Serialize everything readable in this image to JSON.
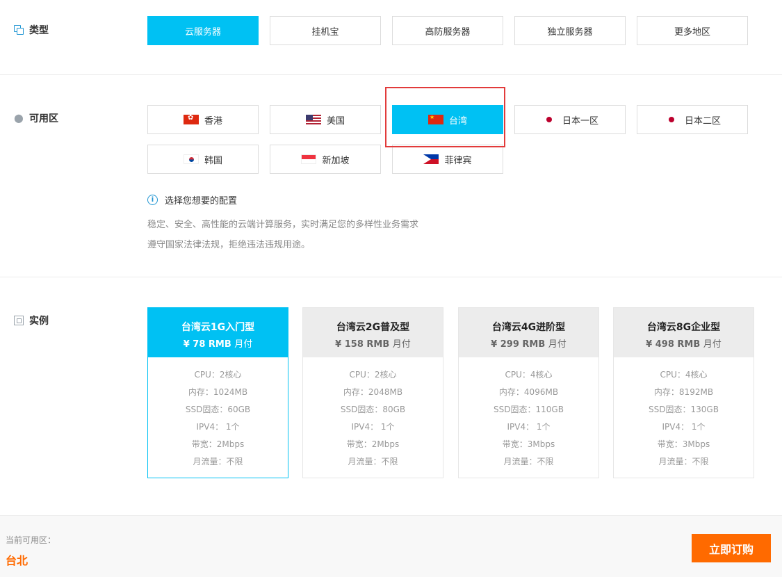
{
  "type_section": {
    "label": "类型",
    "icon": "copy-icon",
    "options": [
      "云服务器",
      "挂机宝",
      "高防服务器",
      "独立服务器",
      "更多地区"
    ],
    "selected": "云服务器"
  },
  "zone_section": {
    "label": "可用区",
    "icon": "location-pin-icon",
    "options": [
      {
        "label": "香港",
        "flag": "hong-kong-flag-icon"
      },
      {
        "label": "美国",
        "flag": "usa-flag-icon"
      },
      {
        "label": "台湾",
        "flag": "china-flag-icon"
      },
      {
        "label": "日本一区",
        "flag": "japan-flag-icon"
      },
      {
        "label": "日本二区",
        "flag": "japan-flag-icon"
      },
      {
        "label": "韩国",
        "flag": "korea-flag-icon"
      },
      {
        "label": "新加坡",
        "flag": "singapore-flag-icon"
      },
      {
        "label": "菲律宾",
        "flag": "philippines-flag-icon"
      }
    ],
    "selected": "台湾",
    "hint_title": "选择您想要的配置",
    "desc_line1": "稳定、安全、高性能的云端计算服务，实时满足您的多样性业务需求",
    "desc_line2": "遵守国家法律法规，拒绝违法违规用途。"
  },
  "instance_section": {
    "label": "实例",
    "icon": "instance-frame-icon",
    "cards": [
      {
        "name": "台湾云1G入门型",
        "price": "¥ 78 RMB",
        "unit": "月付",
        "specs": [
          "CPU：2核心",
          "内存：1024MB",
          "SSD固态：60GB",
          "IPV4： 1个",
          "带宽：2Mbps",
          "月流量：不限"
        ]
      },
      {
        "name": "台湾云2G普及型",
        "price": "¥ 158 RMB",
        "unit": "月付",
        "specs": [
          "CPU：2核心",
          "内存：2048MB",
          "SSD固态：80GB",
          "IPV4： 1个",
          "带宽：2Mbps",
          "月流量：不限"
        ]
      },
      {
        "name": "台湾云4G进阶型",
        "price": "¥ 299 RMB",
        "unit": "月付",
        "specs": [
          "CPU：4核心",
          "内存：4096MB",
          "SSD固态：110GB",
          "IPV4： 1个",
          "带宽：3Mbps",
          "月流量：不限"
        ]
      },
      {
        "name": "台湾云8G企业型",
        "price": "¥ 498 RMB",
        "unit": "月付",
        "specs": [
          "CPU：4核心",
          "内存：8192MB",
          "SSD固态：130GB",
          "IPV4： 1个",
          "带宽：3Mbps",
          "月流量：不限"
        ]
      }
    ],
    "selected_index": 0
  },
  "footer": {
    "current_zone_label": "当前可用区：",
    "current_zone_value": "台北",
    "order_button": "立即订购"
  },
  "colors": {
    "accent": "#00c1f3",
    "order": "#ff6a00",
    "highlight_border": "#e23b3b"
  }
}
